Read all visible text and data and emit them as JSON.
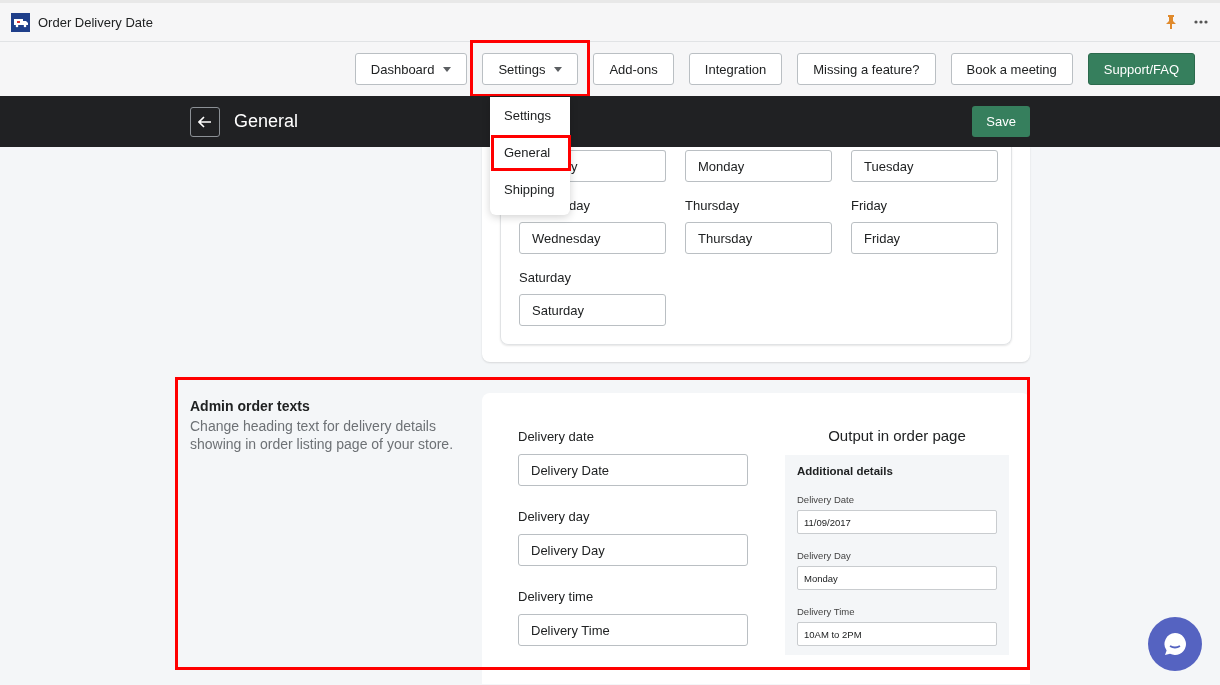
{
  "app": {
    "title": "Order Delivery Date"
  },
  "nav": [
    {
      "label": "Dashboard",
      "kind": "dropdown",
      "highlighted": false
    },
    {
      "label": "Settings",
      "kind": "dropdown",
      "highlighted": true
    },
    {
      "label": "Add-ons",
      "kind": "plain",
      "highlighted": false
    },
    {
      "label": "Integration",
      "kind": "plain",
      "highlighted": false
    },
    {
      "label": "Missing a feature?",
      "kind": "plain",
      "highlighted": false
    },
    {
      "label": "Book a meeting",
      "kind": "plain",
      "highlighted": false
    },
    {
      "label": "Support/FAQ",
      "kind": "primary",
      "highlighted": false
    }
  ],
  "menu": [
    {
      "label": "Settings",
      "highlighted": false
    },
    {
      "label": "General",
      "highlighted": true
    },
    {
      "label": "Shipping",
      "highlighted": false
    }
  ],
  "header": {
    "title": "General",
    "save": "Save"
  },
  "days": [
    {
      "value": "y",
      "cut": true
    },
    {
      "value": "Monday"
    },
    {
      "value": "Tuesday"
    },
    {
      "label": "day",
      "label_cut": true,
      "value": "Wednesday"
    },
    {
      "label": "Thursday",
      "value": "Thursday"
    },
    {
      "label": "Friday",
      "value": "Friday"
    },
    {
      "label": "Saturday",
      "value": "Saturday"
    }
  ],
  "admin": {
    "highlighted": true,
    "title": "Admin order texts",
    "description": "Change heading text for delivery details showing in order listing page of your store.",
    "fields": [
      {
        "label": "Delivery date",
        "value": "Delivery Date"
      },
      {
        "label": "Delivery day",
        "value": "Delivery Day"
      },
      {
        "label": "Delivery time",
        "value": "Delivery Time"
      }
    ],
    "output": {
      "title": "Output in order page",
      "panel_title": "Additional details",
      "fields": [
        {
          "label": "Delivery Date",
          "value": "11/09/2017"
        },
        {
          "label": "Delivery Day",
          "value": "Monday"
        },
        {
          "label": "Delivery Time",
          "value": "10AM to 2PM"
        }
      ]
    }
  }
}
